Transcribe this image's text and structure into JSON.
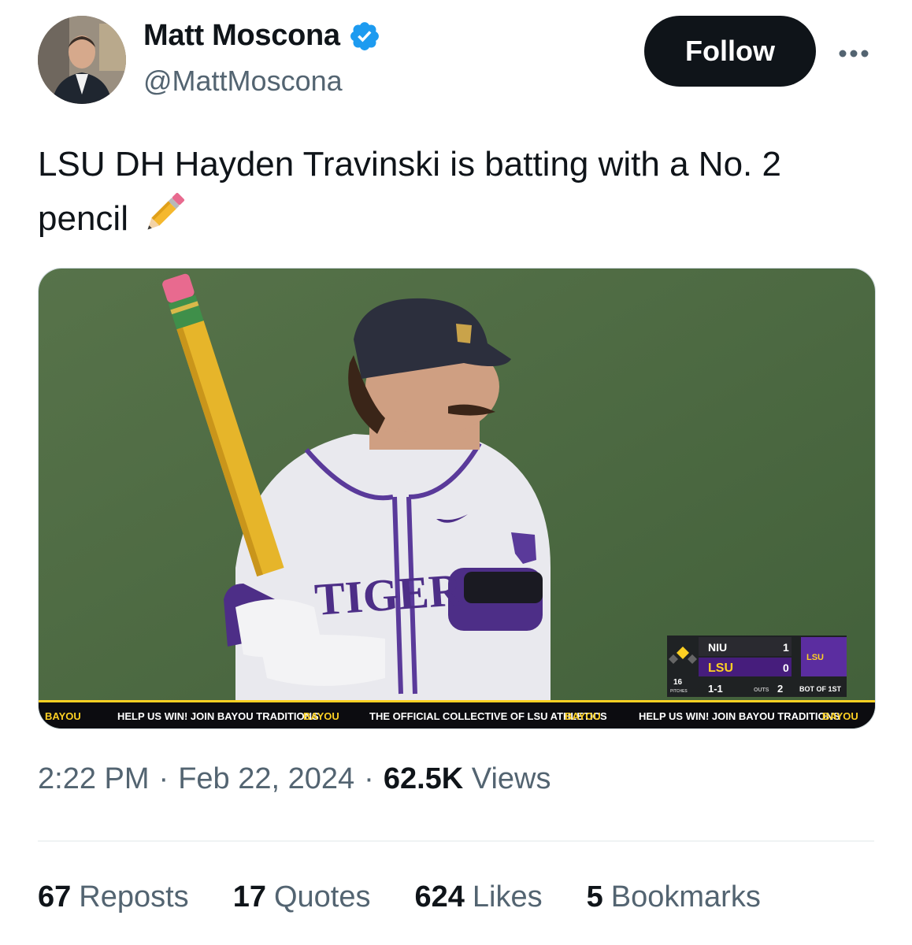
{
  "author": {
    "name": "Matt Moscona",
    "handle": "@MattMoscona",
    "verified_icon": "verified-badge-icon",
    "avatar": "profile-photo"
  },
  "actions": {
    "follow_label": "Follow",
    "more_icon": "more-options-icon"
  },
  "tweet": {
    "text": "LSU DH Hayden Travinski is batting with a No. 2 pencil",
    "emoji": "✏️"
  },
  "media": {
    "jersey_text": "TIGER",
    "scorebug": {
      "away_team": "NIU",
      "away_score": "1",
      "home_team": "LSU",
      "home_score": "0",
      "pitches": "16",
      "pitches_label": "PITCHES",
      "count": "1-1",
      "outs_label": "OUTS",
      "outs": "2",
      "inning": "BOT OF 1ST",
      "sponsor": "LSU"
    },
    "ticker": [
      "BAYOU",
      "HELP US WIN! JOIN BAYOU TRADITIONS",
      "BAYOU",
      "THE OFFICIAL COLLECTIVE OF LSU ATHLETICS",
      "BAYOU",
      "HELP US WIN! JOIN BAYOU TRADITIONS",
      "BAYOU"
    ]
  },
  "meta": {
    "time": "2:22 PM",
    "sep": "·",
    "date": "Feb 22, 2024",
    "views_count": "62.5K",
    "views_label": "Views"
  },
  "stats": [
    {
      "count": "67",
      "label": "Reposts"
    },
    {
      "count": "17",
      "label": "Quotes"
    },
    {
      "count": "624",
      "label": "Likes"
    },
    {
      "count": "5",
      "label": "Bookmarks"
    }
  ],
  "colors": {
    "accent": "#1d9bf0",
    "lsu_purple": "#461d7c",
    "lsu_gold": "#fdd023",
    "field": "#4d6b3c"
  }
}
